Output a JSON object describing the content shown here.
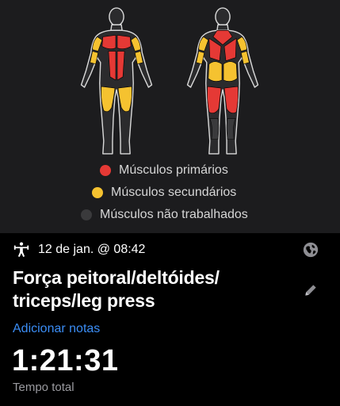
{
  "colors": {
    "primary": "#e53935",
    "secondary": "#f5c230",
    "not_worked": "#3a3a3c",
    "link": "#3b8df5",
    "panel_bg": "#1c1c1e"
  },
  "legend": {
    "primary": "Músculos primários",
    "secondary": "Músculos secundários",
    "not_worked": "Músculos não trabalhados"
  },
  "workout": {
    "activity_icon": "strength-training-icon",
    "date_time": "12 de jan. @ 08:42",
    "title": "Força peitoral/deltóides/ triceps/leg press",
    "add_notes": "Adicionar notas",
    "duration": "1:21:31",
    "duration_label": "Tempo total"
  },
  "actions": {
    "share_icon": "globe-icon",
    "edit_icon": "pencil-icon"
  }
}
